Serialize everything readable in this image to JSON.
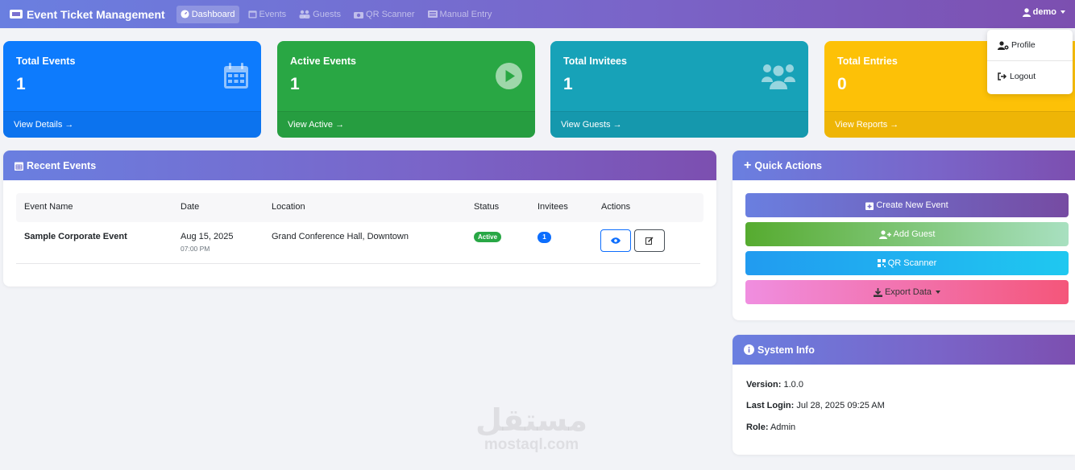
{
  "navbar": {
    "brand": "Event Ticket Management",
    "items": [
      {
        "label": "Dashboard",
        "active": true,
        "icon": "dashboard-icon"
      },
      {
        "label": "Events",
        "active": false,
        "icon": "calendar-icon"
      },
      {
        "label": "Guests",
        "active": false,
        "icon": "users-icon"
      },
      {
        "label": "QR Scanner",
        "active": false,
        "icon": "camera-icon"
      },
      {
        "label": "Manual Entry",
        "active": false,
        "icon": "keyboard-icon"
      }
    ],
    "user": "demo"
  },
  "user_dropdown": {
    "profile": "Profile",
    "logout": "Logout"
  },
  "stats": [
    {
      "title": "Total Events",
      "value": "1",
      "link": "View Details",
      "color": "#0d7bfd",
      "icon": "calendar-icon"
    },
    {
      "title": "Active Events",
      "value": "1",
      "link": "View Active",
      "color": "#29a744",
      "icon": "play-icon"
    },
    {
      "title": "Total Invitees",
      "value": "1",
      "link": "View Guests",
      "color": "#17a2b8",
      "icon": "users-icon"
    },
    {
      "title": "Total Entries",
      "value": "0",
      "link": "View Reports",
      "color": "#fdc107",
      "icon": "ticket-icon"
    }
  ],
  "recent_events": {
    "title": "Recent Events",
    "columns": [
      "Event Name",
      "Date",
      "Location",
      "Status",
      "Invitees",
      "Actions"
    ],
    "rows": [
      {
        "name": "Sample Corporate Event",
        "date": "Aug 15, 2025",
        "time": "07:00 PM",
        "location": "Grand Conference Hall, Downtown",
        "status": "Active",
        "invitees": "1"
      }
    ]
  },
  "quick_actions": {
    "title": "Quick Actions",
    "buttons": [
      {
        "label": "Create New Event",
        "icon": "calendar-plus-icon"
      },
      {
        "label": "Add Guest",
        "icon": "user-plus-icon"
      },
      {
        "label": "QR Scanner",
        "icon": "qrcode-icon"
      },
      {
        "label": "Export Data",
        "icon": "download-icon"
      }
    ]
  },
  "system_info": {
    "title": "System Info",
    "version_label": "Version:",
    "version": "1.0.0",
    "last_login_label": "Last Login:",
    "last_login": "Jul 28, 2025 09:25 AM",
    "role_label": "Role:",
    "role": "Admin"
  },
  "watermark": {
    "arabic": "مستقل",
    "latin": "mostaql.com"
  }
}
